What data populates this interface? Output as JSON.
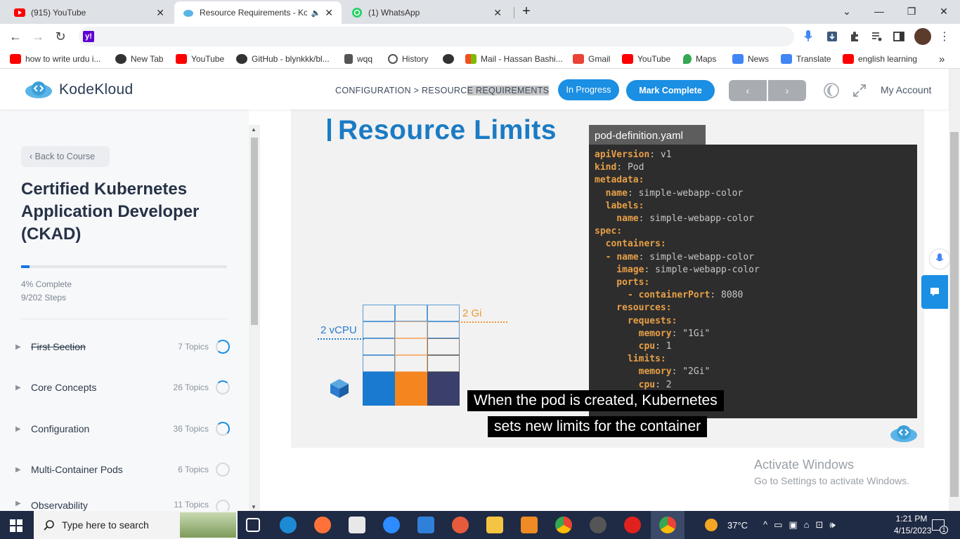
{
  "browser": {
    "tabs": [
      {
        "title": "(915) YouTube",
        "icon": "youtube-icon"
      },
      {
        "title": "Resource Requirements - Ko",
        "icon": "kodekloud-icon"
      },
      {
        "title": "(1) WhatsApp",
        "icon": "whatsapp-icon"
      }
    ],
    "new_tab": "+",
    "address_icon": "y!",
    "bookmarks": [
      {
        "label": "how to write urdu i...",
        "icon": "youtube-icon",
        "color": "#ff0000"
      },
      {
        "label": "New Tab",
        "icon": "globe-icon",
        "color": "#333333"
      },
      {
        "label": "YouTube",
        "icon": "youtube-icon",
        "color": "#ff0000"
      },
      {
        "label": "GitHub - blynkkk/bl...",
        "icon": "github-icon",
        "color": "#333333"
      },
      {
        "label": "wqq",
        "icon": "download-icon",
        "color": "#333333"
      },
      {
        "label": "History",
        "icon": "history-icon",
        "color": "#333333"
      },
      {
        "label": "",
        "icon": "globe-icon",
        "color": "#333333"
      },
      {
        "label": "Mail - Hassan Bashi...",
        "icon": "microsoft-icon",
        "color": "#f25022"
      },
      {
        "label": "Gmail",
        "icon": "gmail-icon",
        "color": "#ea4335"
      },
      {
        "label": "YouTube",
        "icon": "youtube-icon",
        "color": "#ff0000"
      },
      {
        "label": "Maps",
        "icon": "maps-icon",
        "color": "#34a853"
      },
      {
        "label": "News",
        "icon": "news-icon",
        "color": "#4285f4"
      },
      {
        "label": "Translate",
        "icon": "translate-icon",
        "color": "#4285f4"
      },
      {
        "label": "english learning",
        "icon": "youtube-icon",
        "color": "#ff0000"
      }
    ],
    "more_bookmarks": "»"
  },
  "site": {
    "logo": "KodeKloud",
    "breadcrumb_plain": "CONFIGURATION > RESOURC",
    "breadcrumb_highlight": "E REQUIREMENTS",
    "status_button": "In Progress",
    "complete_button": "Mark Complete",
    "prev_label": "‹",
    "next_label": "›",
    "account": "My Account"
  },
  "sidebar": {
    "back": "‹  Back to Course",
    "course_title": "Certified Kubernetes Application Developer (CKAD)",
    "progress_percent": 4,
    "complete_text": "4% Complete",
    "steps_text": "9/202 Steps",
    "sections": [
      {
        "name": "First Section",
        "topics": "7 Topics",
        "done": true
      },
      {
        "name": "Core Concepts",
        "topics": "26 Topics",
        "done": false
      },
      {
        "name": "Configuration",
        "topics": "36 Topics",
        "done": false
      },
      {
        "name": "Multi-Container Pods",
        "topics": "6 Topics",
        "done": false
      },
      {
        "name": "Observability",
        "topics": "11 Topics",
        "done": false
      }
    ]
  },
  "video": {
    "slide_title": "Resource Limits",
    "yaml_filename": "pod-definition.yaml",
    "yaml_lines": [
      [
        {
          "t": "apiVersion",
          "c": "k"
        },
        {
          "t": ": v1",
          "c": "v"
        }
      ],
      [
        {
          "t": "kind",
          "c": "k"
        },
        {
          "t": ": Pod",
          "c": "v"
        }
      ],
      [
        {
          "t": "metadata:",
          "c": "k"
        }
      ],
      [
        {
          "t": "  name",
          "c": "k"
        },
        {
          "t": ": simple-webapp-color",
          "c": "v"
        }
      ],
      [
        {
          "t": "  labels:",
          "c": "k"
        }
      ],
      [
        {
          "t": "    name",
          "c": "k"
        },
        {
          "t": ": simple-webapp-color",
          "c": "v"
        }
      ],
      [
        {
          "t": "spec:",
          "c": "k"
        }
      ],
      [
        {
          "t": "  containers:",
          "c": "k"
        }
      ],
      [
        {
          "t": "  - ",
          "c": "k"
        },
        {
          "t": "name",
          "c": "k"
        },
        {
          "t": ": simple-webapp-color",
          "c": "v"
        }
      ],
      [
        {
          "t": "    image",
          "c": "k"
        },
        {
          "t": ": simple-webapp-color",
          "c": "v"
        }
      ],
      [
        {
          "t": "    ports:",
          "c": "k"
        }
      ],
      [
        {
          "t": "      - containerPort",
          "c": "k"
        },
        {
          "t": ": 8080",
          "c": "v"
        }
      ],
      [
        {
          "t": "    resources:",
          "c": "k"
        }
      ],
      [
        {
          "t": "      requests:",
          "c": "k"
        }
      ],
      [
        {
          "t": "        memory",
          "c": "k"
        },
        {
          "t": ": \"1Gi\"",
          "c": "v"
        }
      ],
      [
        {
          "t": "        cpu",
          "c": "k"
        },
        {
          "t": ": 1",
          "c": "v"
        }
      ],
      [
        {
          "t": "      limits:",
          "c": "k"
        }
      ],
      [
        {
          "t": "        memory",
          "c": "k"
        },
        {
          "t": ": \"2Gi\"",
          "c": "v"
        }
      ],
      [
        {
          "t": "        cpu",
          "c": "k"
        },
        {
          "t": ": 2",
          "c": "v"
        }
      ]
    ],
    "label_mem": "2 Gi",
    "label_cpu": "2 vCPU",
    "subtitle_line1": "When the pod is created, Kubernetes",
    "subtitle_line2": "sets new limits for the container"
  },
  "watermark": {
    "line1": "Activate Windows",
    "line2": "Go to Settings to activate Windows."
  },
  "taskbar": {
    "search_placeholder": "Type here to search",
    "weather": "37°C",
    "time": "1:21 PM",
    "date": "4/15/2023",
    "notification_count": "1"
  }
}
